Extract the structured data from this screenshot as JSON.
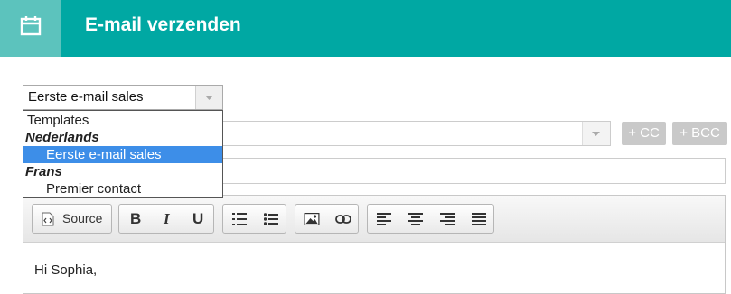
{
  "header": {
    "title": "E-mail verzenden",
    "icon": "calendar-icon"
  },
  "template_select": {
    "value": "Eerste e-mail sales"
  },
  "dropdown": {
    "items": [
      {
        "label": "Templates",
        "kind": "header"
      },
      {
        "label": "Nederlands",
        "kind": "group"
      },
      {
        "label": "Eerste e-mail sales",
        "kind": "option",
        "selected": true
      },
      {
        "label": "Frans",
        "kind": "group"
      },
      {
        "label": "Premier contact",
        "kind": "option",
        "selected": false
      }
    ]
  },
  "recipients": {
    "cc_label": "+ CC",
    "bcc_label": "+ BCC"
  },
  "toolbar": {
    "source_label": "Source",
    "bold_label": "B",
    "italic_label": "I",
    "underline_label": "U"
  },
  "editor": {
    "body_text": "Hi Sophia,"
  },
  "colors": {
    "header": "#00a8a3",
    "header_icon_box": "#5cc3bd",
    "selected_option": "#3d8ee8",
    "disabled_button": "#c9c9c9"
  }
}
